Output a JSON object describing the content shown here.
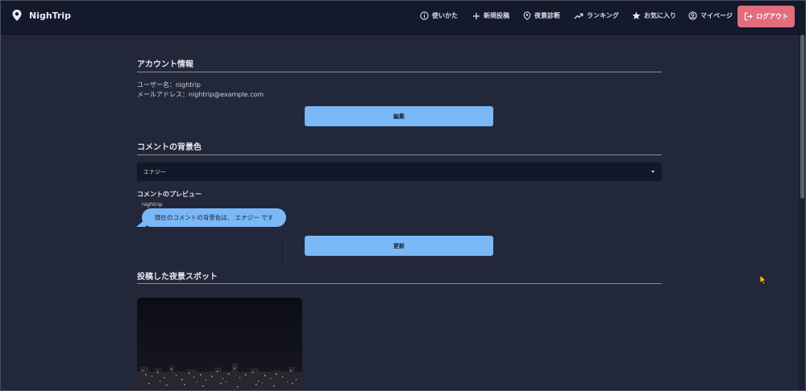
{
  "header": {
    "brand": "NighTrip",
    "nav": [
      {
        "label": "使いかた",
        "icon": "info-icon"
      },
      {
        "label": "新規投稿",
        "icon": "plus-icon"
      },
      {
        "label": "夜景診断",
        "icon": "map-pin-icon"
      },
      {
        "label": "ランキング",
        "icon": "trending-up-icon"
      },
      {
        "label": "お気に入り",
        "icon": "star-icon"
      },
      {
        "label": "マイページ",
        "icon": "user-circle-icon"
      }
    ],
    "logout": {
      "label": "ログアウト",
      "icon": "logout-icon"
    }
  },
  "account": {
    "title": "アカウント情報",
    "username_line": "ユーザー名：nightrip",
    "email_line": "メールアドレス：nightrip@example.com",
    "edit_button": "編集"
  },
  "comment_bg": {
    "title": "コメントの背景色",
    "selected": "エナジー",
    "preview_label": "コメントのプレビュー",
    "preview_user": "nightrip",
    "preview_text": "現在のコメントの背景色は、 エナジー です",
    "update_button": "更新"
  },
  "spots": {
    "title": "投稿した夜景スポット"
  },
  "colors": {
    "accent": "#7ab8f7",
    "logout": "#e26d7d",
    "header_bg": "#141a2b",
    "page_bg": "#222839"
  }
}
